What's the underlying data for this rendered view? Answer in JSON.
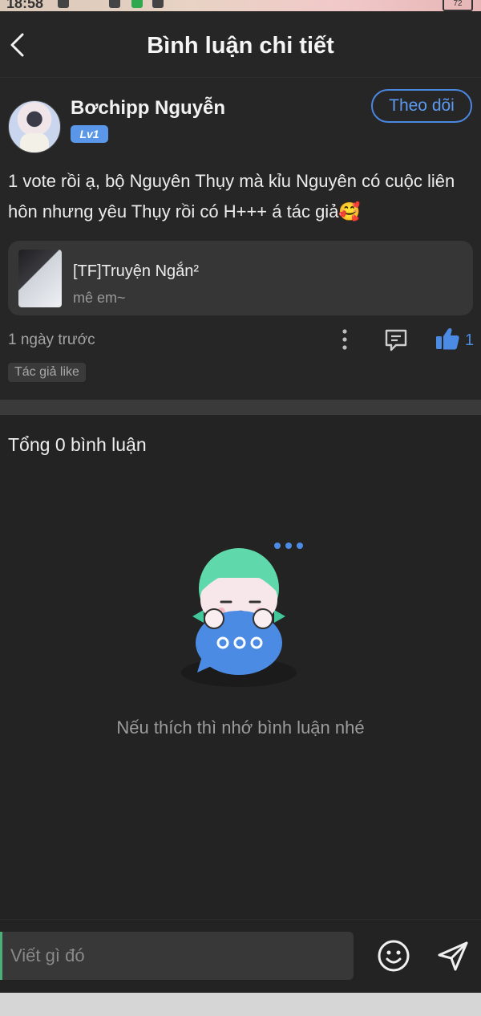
{
  "status_bar": {
    "time": "18:58",
    "battery": "72"
  },
  "header": {
    "title": "Bình luận chi tiết"
  },
  "comment": {
    "author": "Bơchipp Nguyễn",
    "level": "Lv1",
    "follow_label": "Theo dõi",
    "text": "1 vote rồi ạ, bộ Nguyên Thụy mà kỉu Nguyên có cuộc liên hôn nhưng yêu Thụy rồi có H+++ á tác giả🥰",
    "book": {
      "title": "[TF]Truyện Ngắn²",
      "subtitle": "mê em~"
    },
    "time_ago": "1 ngày trước",
    "like_count": "1",
    "tag": "Tác giả like"
  },
  "replies": {
    "total_label": "Tổng 0 bình luận",
    "empty_text": "Nếu thích thì nhớ bình luận nhé"
  },
  "input": {
    "placeholder": "Viết gì đó"
  },
  "icons": {
    "back": "chevron-left-icon",
    "more": "more-vertical-icon",
    "reply": "comment-icon",
    "like": "thumbs-up-icon",
    "emoji": "smiley-icon",
    "send": "send-icon"
  },
  "colors": {
    "accent": "#4a88e0",
    "background": "#232323",
    "card": "#262626"
  }
}
